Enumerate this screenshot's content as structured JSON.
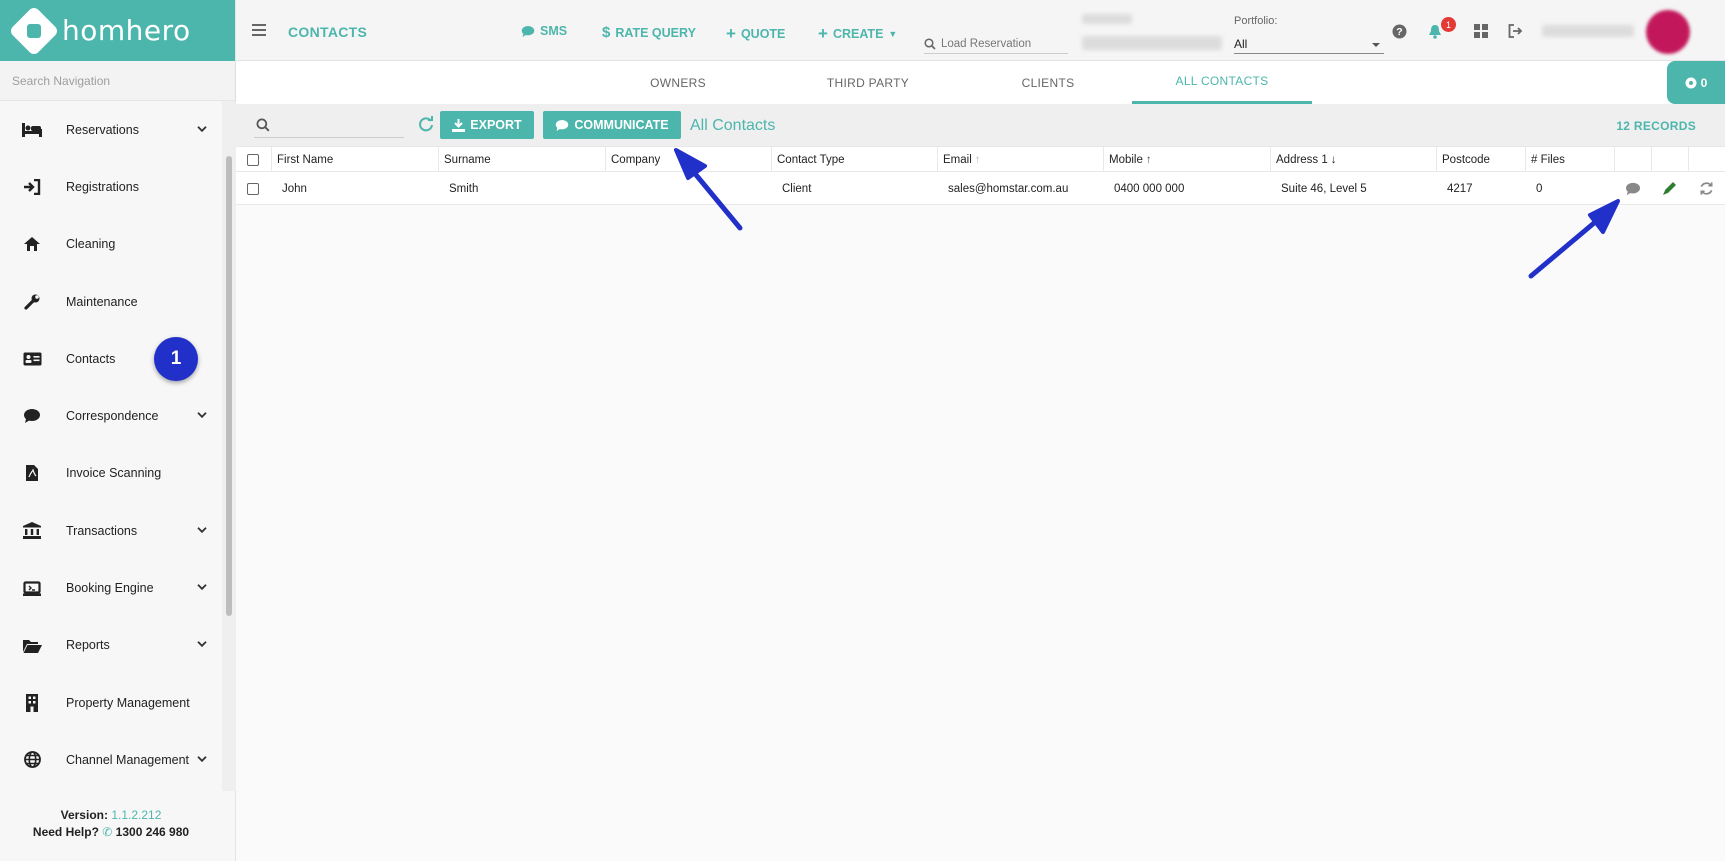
{
  "brand": {
    "name": "homhero",
    "accent": "#4db6ac"
  },
  "sidebar": {
    "search_placeholder": "Search Navigation",
    "items": [
      {
        "label": "Reservations",
        "icon": "bed-icon",
        "chevron": true
      },
      {
        "label": "Registrations",
        "icon": "sign-in-icon",
        "chevron": false
      },
      {
        "label": "Cleaning",
        "icon": "home-icon",
        "chevron": false
      },
      {
        "label": "Maintenance",
        "icon": "wrench-icon",
        "chevron": false
      },
      {
        "label": "Contacts",
        "icon": "id-card-icon",
        "chevron": false
      },
      {
        "label": "Correspondence",
        "icon": "chat-icon",
        "chevron": true
      },
      {
        "label": "Invoice Scanning",
        "icon": "pdf-file-icon",
        "chevron": false
      },
      {
        "label": "Transactions",
        "icon": "bank-icon",
        "chevron": true
      },
      {
        "label": "Booking Engine",
        "icon": "laptop-icon",
        "chevron": true
      },
      {
        "label": "Reports",
        "icon": "folder-open-icon",
        "chevron": true
      },
      {
        "label": "Property Management",
        "icon": "building-icon",
        "chevron": false
      },
      {
        "label": "Channel Management",
        "icon": "globe-icon",
        "chevron": true
      }
    ],
    "step_badge": "1",
    "footer": {
      "version_label": "Version:",
      "version": "1.1.2.212",
      "help_label": "Need Help?",
      "phone": "1300 246 980"
    }
  },
  "topbar": {
    "title": "CONTACTS",
    "actions": [
      {
        "label": "SMS",
        "icon": "chat-icon"
      },
      {
        "label": "RATE QUERY",
        "icon": "dollar-icon"
      },
      {
        "label": "QUOTE",
        "icon": "plus-icon"
      },
      {
        "label": "CREATE",
        "icon": "plus-icon"
      }
    ],
    "load_reservation_placeholder": "Load Reservation",
    "portfolio_label": "Portfolio:",
    "portfolio_value": "All",
    "notification_count": "1"
  },
  "tabs": [
    {
      "label": "OWNERS",
      "active": false
    },
    {
      "label": "THIRD PARTY",
      "active": false
    },
    {
      "label": "CLIENTS",
      "active": false
    },
    {
      "label": "ALL CONTACTS",
      "active": true
    }
  ],
  "counter_pill": "0",
  "toolbar": {
    "export_label": "EXPORT",
    "communicate_label": "COMMUNICATE",
    "title": "All Contacts",
    "records": "12 RECORDS"
  },
  "table": {
    "columns": [
      "First Name",
      "Surname",
      "Company",
      "Contact Type",
      "Email",
      "Mobile",
      "Address 1",
      "Postcode",
      "# Files"
    ],
    "rows": [
      {
        "first_name": "John",
        "surname": "Smith",
        "company": "",
        "contact_type": "Client",
        "email": "sales@homstar.com.au",
        "mobile": "0400 000 000",
        "address1": "Suite 46, Level 5",
        "postcode": "4217",
        "files": "0"
      }
    ]
  },
  "colors": {
    "accent": "#4db6ac",
    "annotation": "#2130c9",
    "notification": "#e53935",
    "edit": "#2e7d32"
  }
}
